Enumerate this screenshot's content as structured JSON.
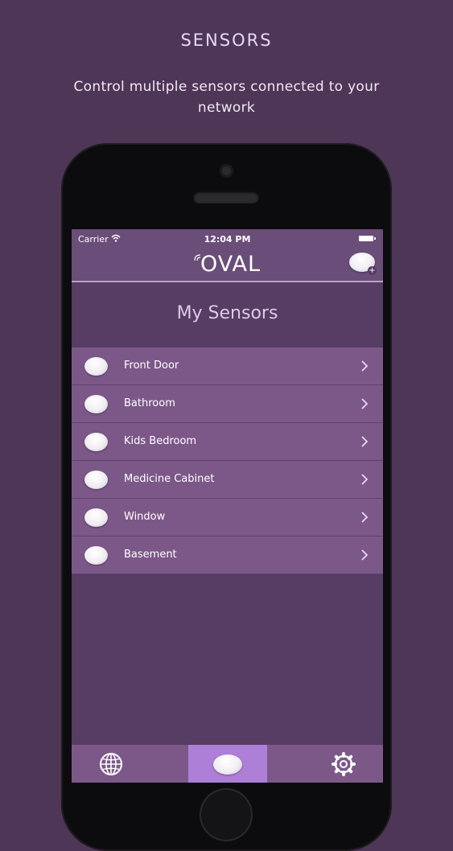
{
  "header": {
    "title": "SENSORS",
    "subtitle": "Control multiple sensors connected to your network"
  },
  "status_bar": {
    "carrier": "Carrier",
    "time": "12:04 PM"
  },
  "nav": {
    "logo": "OVAL"
  },
  "main": {
    "title": "My Sensors",
    "sensors": [
      {
        "name": "Front Door"
      },
      {
        "name": "Bathroom"
      },
      {
        "name": "Kids Bedroom"
      },
      {
        "name": "Medicine Cabinet"
      },
      {
        "name": "Window"
      },
      {
        "name": "Basement"
      }
    ]
  },
  "tabs": [
    {
      "icon": "globe-icon",
      "selected": false
    },
    {
      "icon": "sensor-icon",
      "selected": true
    },
    {
      "icon": "gear-icon",
      "selected": false
    }
  ],
  "colors": {
    "background": "#4e3656",
    "screen": "#573c63",
    "bar": "#6a4d78",
    "row": "#7c5889",
    "selected_tab": "#ad7fd7"
  }
}
